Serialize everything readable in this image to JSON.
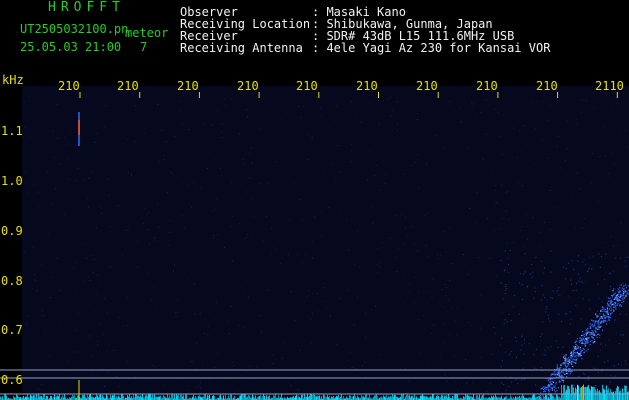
{
  "header": {
    "brand": "HROFFT",
    "filename": "UT2505032100.pn",
    "mode": "meteor",
    "datetime": "25.05.03 21:00",
    "count": "7",
    "fields": [
      {
        "label": "Observer",
        "value": ": Masaki Kano"
      },
      {
        "label": "Receiving Location",
        "value": ": Shibukawa, Gunma, Japan"
      },
      {
        "label": "Receiver",
        "value": ": SDR# 43dB L15 111.6MHz USB"
      },
      {
        "label": "Receiving Antenna",
        "value": ": 4ele Yagi Az 230 for Kansai VOR"
      }
    ]
  },
  "axis": {
    "unit": "kHz",
    "time_ticks": [
      "210",
      "210",
      "210",
      "210",
      "210",
      "210",
      "210",
      "210",
      "210",
      "2110"
    ],
    "freq_ticks": [
      "1.1",
      "1.0",
      "0.9",
      "0.8",
      "0.7",
      "0.6"
    ]
  },
  "colors": {
    "header_text": "#1fd21f",
    "label_text": "#f2f2f2",
    "tick_text": "#e7e000",
    "signal": "#2a6bff",
    "noise_floor": "#00e5ff"
  }
}
